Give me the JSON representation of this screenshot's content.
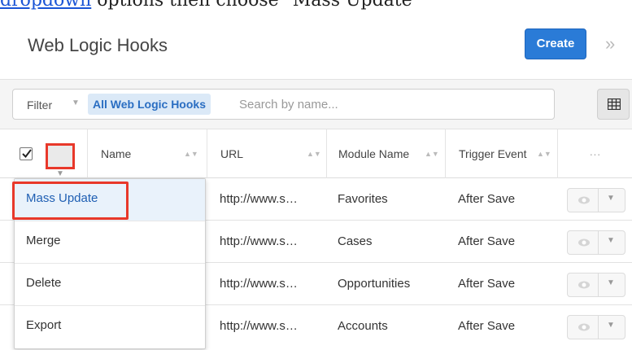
{
  "doc": {
    "link_text": "dropdown",
    "rest_text": " options then choose \"Mass Update\""
  },
  "header": {
    "title": "Web Logic Hooks",
    "create_label": "Create",
    "expand_glyph": "»"
  },
  "filter": {
    "label": "Filter",
    "pill": "All Web Logic Hooks",
    "search_placeholder": "Search by name..."
  },
  "table": {
    "columns": [
      "Name",
      "URL",
      "Module Name",
      "Trigger Event"
    ],
    "actions_header": "···",
    "rows": [
      {
        "url": "http://www.s…",
        "module": "Favorites",
        "trigger": "After Save"
      },
      {
        "url": "http://www.s…",
        "module": "Cases",
        "trigger": "After Save"
      },
      {
        "url": "http://www.s…",
        "module": "Opportunities",
        "trigger": "After Save"
      },
      {
        "url": "http://www.s…",
        "module": "Accounts",
        "trigger": "After Save"
      }
    ]
  },
  "menu": {
    "items": [
      "Mass Update",
      "Merge",
      "Delete",
      "Export"
    ],
    "active": "Mass Update"
  },
  "colors": {
    "accent": "#2a7bd7",
    "highlight": "#e8382a",
    "pill_bg": "#dbe9f7"
  }
}
